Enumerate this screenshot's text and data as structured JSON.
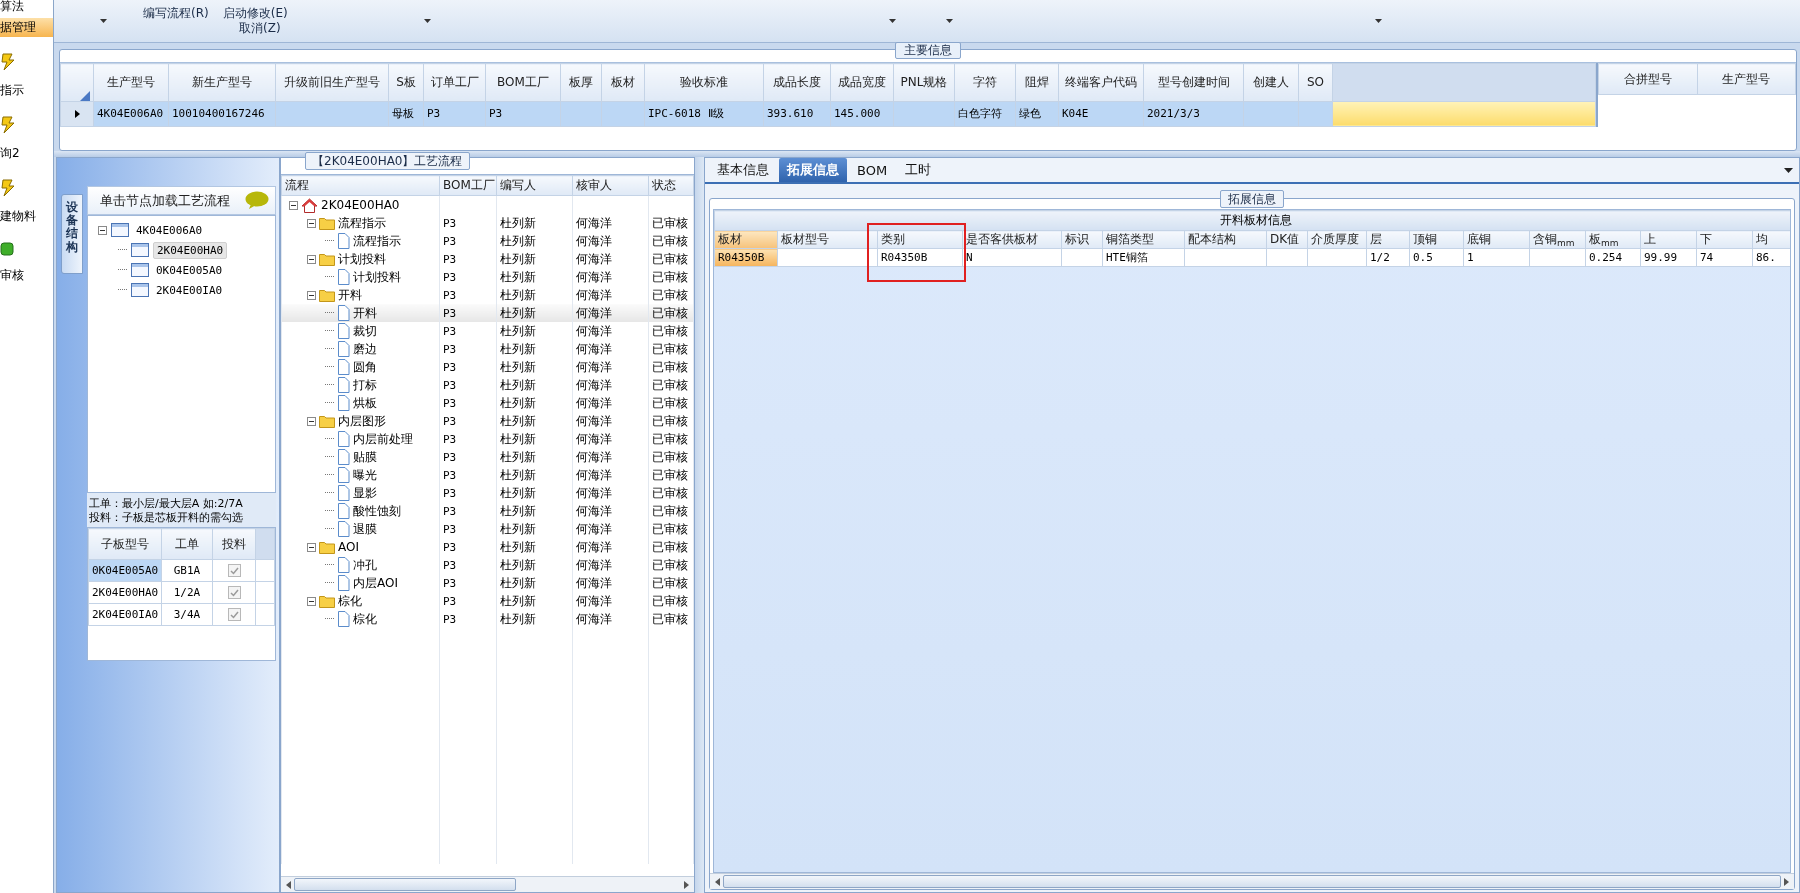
{
  "sidebar": {
    "items": [
      {
        "label": "算法",
        "kind": "text",
        "selected": false
      },
      {
        "label": "据管理",
        "kind": "text",
        "selected": true
      },
      {
        "label": "指示",
        "kind": "tool",
        "selected": false
      },
      {
        "label": "询2",
        "kind": "tool",
        "selected": false
      },
      {
        "label": "建物料",
        "kind": "tool",
        "selected": false
      },
      {
        "label": "审核",
        "kind": "check",
        "selected": false
      }
    ]
  },
  "ribbon": {
    "commands": [
      "编写流程(R)",
      "启动修改(E)",
      "取消(Z)"
    ]
  },
  "main_info": {
    "title": "主要信息",
    "columns": [
      "生产型号",
      "新生产型号",
      "升级前旧生产型号",
      "S板",
      "订单工厂",
      "BOM工厂",
      "板厚",
      "板材",
      "验收标准",
      "成品长度",
      "成品宽度",
      "PNL规格",
      "字符",
      "阻焊",
      "终端客户代码",
      "型号创建时间",
      "创建人",
      "SO"
    ],
    "rows": [
      {
        "selected": true,
        "cells": [
          "4K04E006A0",
          "10010400167246",
          null,
          "母板",
          "P3",
          "P3",
          null,
          null,
          "IPC-6018 Ⅱ级",
          "393.610",
          "145.000",
          null,
          "白色字符",
          "绿色",
          "K04E",
          "2021/3/3",
          null,
          null
        ]
      }
    ]
  },
  "merge_grid": {
    "columns": [
      "合拼型号",
      "生产型号"
    ]
  },
  "structure_panel": {
    "tab": "设备结构",
    "header": "单击节点加载工艺流程",
    "tree": [
      {
        "label": "4K04E006A0",
        "expanded": true,
        "selected": false,
        "children": [
          {
            "label": "2K04E00HA0",
            "selected": true
          },
          {
            "label": "0K04E005A0",
            "selected": false
          },
          {
            "label": "2K04E00IA0",
            "selected": false
          }
        ]
      }
    ],
    "notes": [
      "工单：最小层/最大层A 如:2/7A",
      "投料：子板是芯板开料的需勾选"
    ],
    "grid": {
      "columns": [
        "子板型号",
        "工单",
        "投料"
      ],
      "rows": [
        {
          "board": "0K04E005A0",
          "order": "GB1A",
          "feed": true,
          "selected": true
        },
        {
          "board": "2K04E00HA0",
          "order": "1/2A",
          "feed": true,
          "selected": false
        },
        {
          "board": "2K04E00IA0",
          "order": "3/4A",
          "feed": true,
          "selected": false
        }
      ]
    }
  },
  "process_panel": {
    "title": "【2K04E00HA0】工艺流程",
    "columns": [
      "流程",
      "BOM工厂",
      "编写人",
      "核审人",
      "状态"
    ],
    "tree": [
      {
        "label": "2K04E00HA0",
        "kind": "root",
        "expanded": true,
        "selected": false,
        "children": [
          {
            "label": "流程指示",
            "kind": "folder",
            "expanded": true,
            "selected": false,
            "bom": "P3",
            "writer": "杜列新",
            "reviewer": "何海洋",
            "status": "已审核",
            "children": [
              {
                "label": "流程指示",
                "kind": "doc",
                "selected": false,
                "bom": "P3",
                "writer": "杜列新",
                "reviewer": "何海洋",
                "status": "已审核"
              }
            ]
          },
          {
            "label": "计划投料",
            "kind": "folder",
            "expanded": true,
            "selected": false,
            "bom": "P3",
            "writer": "杜列新",
            "reviewer": "何海洋",
            "status": "已审核",
            "children": [
              {
                "label": "计划投料",
                "kind": "doc",
                "selected": false,
                "bom": "P3",
                "writer": "杜列新",
                "reviewer": "何海洋",
                "status": "已审核"
              }
            ]
          },
          {
            "label": "开料",
            "kind": "folder",
            "expanded": true,
            "selected": false,
            "bom": "P3",
            "writer": "杜列新",
            "reviewer": "何海洋",
            "status": "已审核",
            "children": [
              {
                "label": "开料",
                "kind": "doc",
                "selected": true,
                "bom": "P3",
                "writer": "杜列新",
                "reviewer": "何海洋",
                "status": "已审核"
              },
              {
                "label": "裁切",
                "kind": "doc",
                "selected": false,
                "bom": "P3",
                "writer": "杜列新",
                "reviewer": "何海洋",
                "status": "已审核"
              },
              {
                "label": "磨边",
                "kind": "doc",
                "selected": false,
                "bom": "P3",
                "writer": "杜列新",
                "reviewer": "何海洋",
                "status": "已审核"
              },
              {
                "label": "圆角",
                "kind": "doc",
                "selected": false,
                "bom": "P3",
                "writer": "杜列新",
                "reviewer": "何海洋",
                "status": "已审核"
              },
              {
                "label": "打标",
                "kind": "doc",
                "selected": false,
                "bom": "P3",
                "writer": "杜列新",
                "reviewer": "何海洋",
                "status": "已审核"
              },
              {
                "label": "烘板",
                "kind": "doc",
                "selected": false,
                "bom": "P3",
                "writer": "杜列新",
                "reviewer": "何海洋",
                "status": "已审核"
              }
            ]
          },
          {
            "label": "内层图形",
            "kind": "folder",
            "expanded": true,
            "selected": false,
            "bom": "P3",
            "writer": "杜列新",
            "reviewer": "何海洋",
            "status": "已审核",
            "children": [
              {
                "label": "内层前处理",
                "kind": "doc",
                "selected": false,
                "bom": "P3",
                "writer": "杜列新",
                "reviewer": "何海洋",
                "status": "已审核"
              },
              {
                "label": "贴膜",
                "kind": "doc",
                "selected": false,
                "bom": "P3",
                "writer": "杜列新",
                "reviewer": "何海洋",
                "status": "已审核"
              },
              {
                "label": "曝光",
                "kind": "doc",
                "selected": false,
                "bom": "P3",
                "writer": "杜列新",
                "reviewer": "何海洋",
                "status": "已审核"
              },
              {
                "label": "显影",
                "kind": "doc",
                "selected": false,
                "bom": "P3",
                "writer": "杜列新",
                "reviewer": "何海洋",
                "status": "已审核"
              },
              {
                "label": "酸性蚀刻",
                "kind": "doc",
                "selected": false,
                "bom": "P3",
                "writer": "杜列新",
                "reviewer": "何海洋",
                "status": "已审核"
              },
              {
                "label": "退膜",
                "kind": "doc",
                "selected": false,
                "bom": "P3",
                "writer": "杜列新",
                "reviewer": "何海洋",
                "status": "已审核"
              }
            ]
          },
          {
            "label": "AOI",
            "kind": "folder",
            "expanded": true,
            "selected": false,
            "bom": "P3",
            "writer": "杜列新",
            "reviewer": "何海洋",
            "status": "已审核",
            "children": [
              {
                "label": "冲孔",
                "kind": "doc",
                "selected": false,
                "bom": "P3",
                "writer": "杜列新",
                "reviewer": "何海洋",
                "status": "已审核"
              },
              {
                "label": "内层AOI",
                "kind": "doc",
                "selected": false,
                "bom": "P3",
                "writer": "杜列新",
                "reviewer": "何海洋",
                "status": "已审核"
              }
            ]
          },
          {
            "label": "棕化",
            "kind": "folder",
            "expanded": true,
            "selected": false,
            "bom": "P3",
            "writer": "杜列新",
            "reviewer": "何海洋",
            "status": "已审核",
            "children": [
              {
                "label": "棕化",
                "kind": "doc",
                "selected": false,
                "bom": "P3",
                "writer": "杜列新",
                "reviewer": "何海洋",
                "status": "已审核"
              }
            ]
          }
        ]
      }
    ]
  },
  "detail_panel": {
    "tabs": [
      {
        "label": "基本信息",
        "selected": false
      },
      {
        "label": "拓展信息",
        "selected": true
      },
      {
        "label": "BOM",
        "selected": false
      },
      {
        "label": "工时",
        "selected": false
      }
    ],
    "group_title": "拓展信息",
    "table": {
      "title": "开料板材信息",
      "columns": [
        {
          "label": "板材",
          "selected": true,
          "highlighted": false
        },
        {
          "label": "板材型号",
          "selected": false,
          "highlighted": false
        },
        {
          "label": "类别",
          "selected": false,
          "highlighted": true
        },
        {
          "label": "是否客供板材",
          "selected": false,
          "highlighted": false
        },
        {
          "label": "标识",
          "selected": false,
          "highlighted": false
        },
        {
          "label": "铜箔类型",
          "selected": false,
          "highlighted": false
        },
        {
          "label": "配本结构",
          "selected": false,
          "highlighted": false
        },
        {
          "label": "DK值",
          "selected": false,
          "highlighted": false
        },
        {
          "label": "介质厚度",
          "selected": false,
          "highlighted": false
        },
        {
          "label": "层",
          "selected": false,
          "highlighted": false
        },
        {
          "label": "顶铜",
          "selected": false,
          "highlighted": false
        },
        {
          "label": "底铜",
          "selected": false,
          "highlighted": false
        },
        {
          "label": "含铜$_{mm}$",
          "selected": false,
          "highlighted": false
        },
        {
          "label": "板$_{mm}$",
          "selected": false,
          "highlighted": false
        },
        {
          "label": "上",
          "selected": false,
          "highlighted": false
        },
        {
          "label": "下",
          "selected": false,
          "highlighted": false
        },
        {
          "label": "均",
          "selected": false,
          "highlighted": false
        }
      ],
      "rows": [
        {
          "cells": [
            "R04350B",
            null,
            "R04350B",
            "N",
            null,
            "HTE铜箔",
            null,
            null,
            null,
            "1/2",
            "0.5",
            "1",
            null,
            "0.254",
            "99.99",
            "74",
            "86."
          ]
        }
      ]
    }
  }
}
